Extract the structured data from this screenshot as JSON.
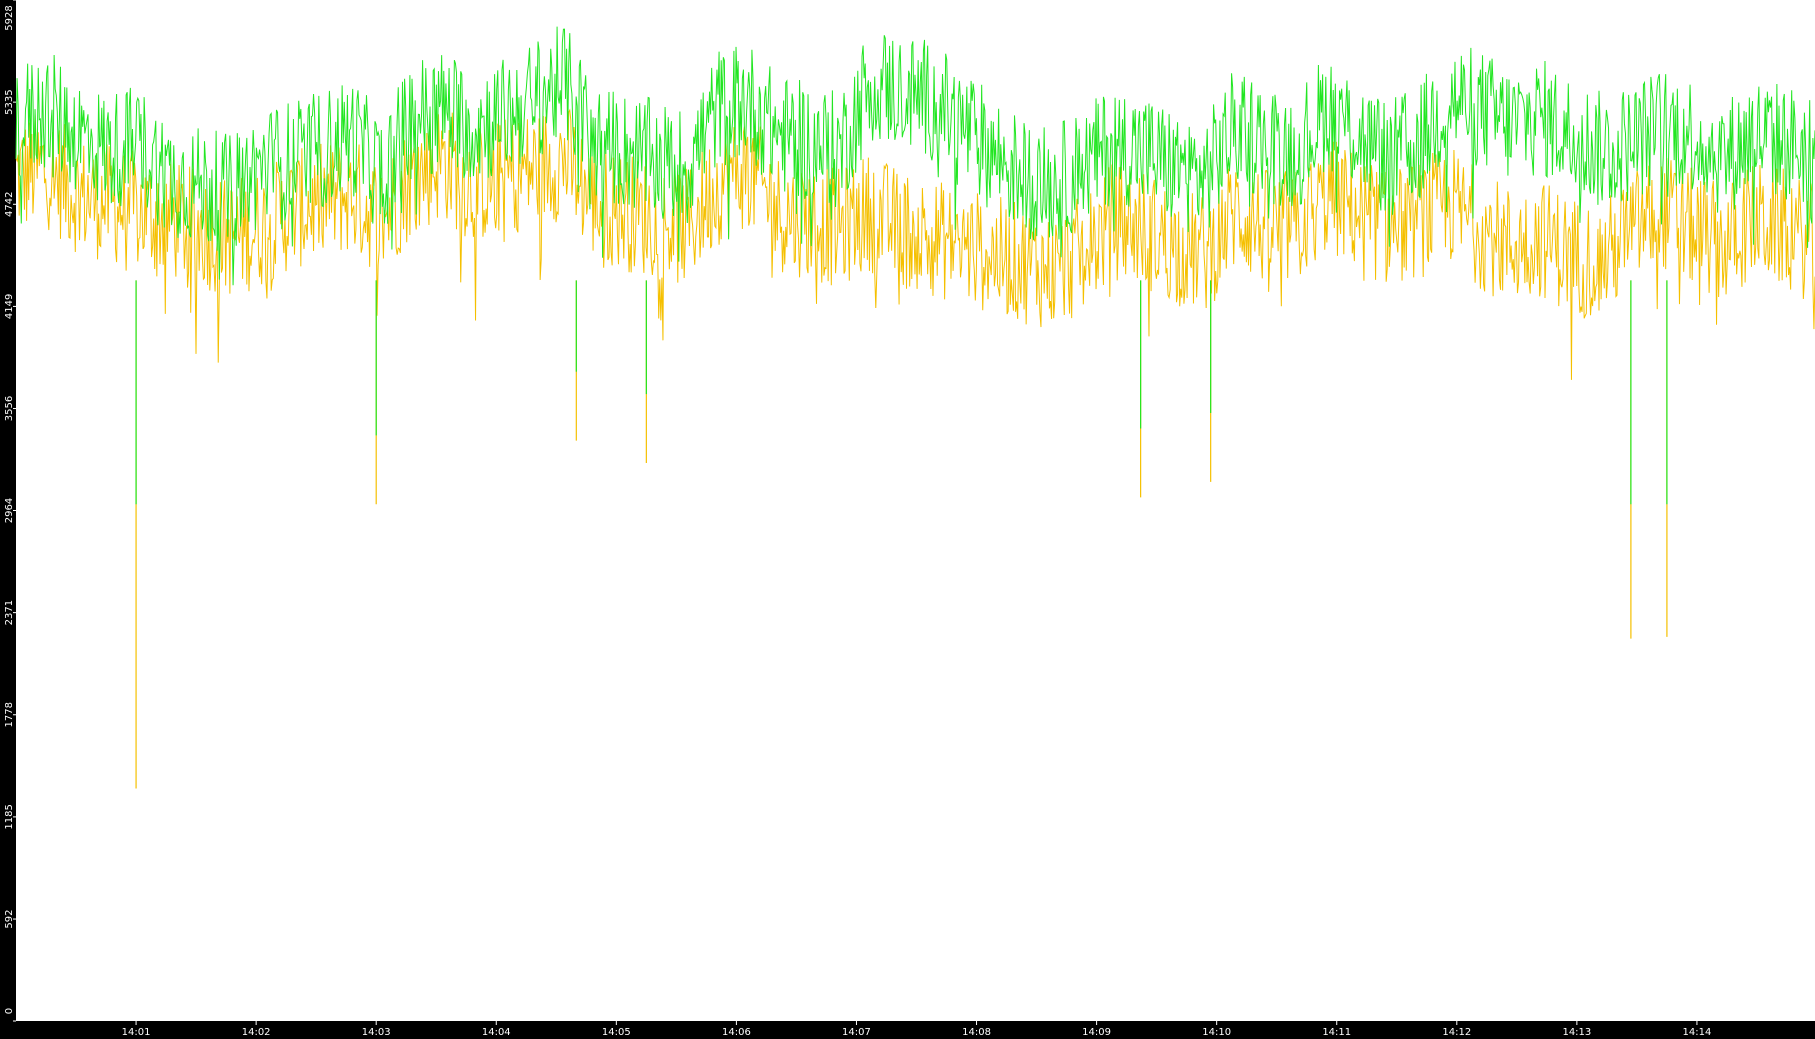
{
  "chart_data": {
    "type": "line",
    "title": "",
    "xlabel": "",
    "ylabel": "",
    "ylim": [
      0,
      5928
    ],
    "y_ticks": [
      "0",
      "592",
      "1185",
      "1778",
      "2371",
      "2964",
      "3556",
      "4149",
      "4742",
      "5335",
      "5928"
    ],
    "x_ticks": [
      "14:01",
      "14:02",
      "14:03",
      "14:04",
      "14:05",
      "14:06",
      "14:07",
      "14:08",
      "14:09",
      "14:10",
      "14:11",
      "14:12",
      "14:13",
      "14:14"
    ],
    "x_range": [
      "14:00:00",
      "14:14:59"
    ],
    "grid": false,
    "legend": "none",
    "colors": {
      "background": "#000000",
      "plot_area": "#ffffff",
      "axis_text": "#ffffff",
      "upper_series": "#22e622",
      "lower_series": "#f5c000"
    },
    "series": [
      {
        "color": "#22e622",
        "typical_range": [
          4200,
          5600
        ],
        "values": [
          5200,
          5300,
          5150,
          5050,
          5100,
          4900,
          4850,
          4800,
          4950,
          5000,
          5050,
          5150,
          4900,
          5250,
          5300,
          5200,
          5250,
          5350,
          5450,
          5100,
          5050,
          5000,
          4950,
          5300,
          5350,
          5150,
          5100,
          5050,
          5450,
          5400,
          5350,
          5200,
          5050,
          4900,
          4850,
          4950,
          5100,
          5050,
          4950,
          4900,
          5200,
          5100,
          5050,
          5300,
          5150,
          5000,
          5100,
          5350,
          5300,
          5200,
          5250,
          5150,
          5050,
          5100,
          5200,
          5150,
          5000,
          5150,
          5100,
          5050
        ]
      },
      {
        "color": "#f5c000",
        "typical_range": [
          3800,
          5300
        ],
        "values": [
          4900,
          4950,
          4800,
          4750,
          4700,
          4650,
          4600,
          4550,
          4600,
          4700,
          4750,
          4800,
          4650,
          4900,
          5000,
          4850,
          4900,
          4950,
          5000,
          4750,
          4700,
          4650,
          4600,
          4850,
          4950,
          4700,
          4650,
          4600,
          4700,
          4600,
          4550,
          4500,
          4450,
          4400,
          4350,
          4450,
          4650,
          4600,
          4500,
          4450,
          4700,
          4600,
          4600,
          4800,
          4700,
          4600,
          4650,
          4750,
          4600,
          4500,
          4550,
          4450,
          4400,
          4600,
          4700,
          4600,
          4500,
          4650,
          4600,
          4500
        ]
      }
    ],
    "dips": [
      {
        "time": "14:01",
        "value": 1350
      },
      {
        "time": "14:03",
        "value": 3000
      },
      {
        "time": "14:04:40",
        "value": 3370
      },
      {
        "time": "14:05:15",
        "value": 3240
      },
      {
        "time": "14:09:22",
        "value": 3040
      },
      {
        "time": "14:09:57",
        "value": 3130
      },
      {
        "time": "14:13:27",
        "value": 2220
      },
      {
        "time": "14:13:45",
        "value": 2230
      }
    ]
  }
}
